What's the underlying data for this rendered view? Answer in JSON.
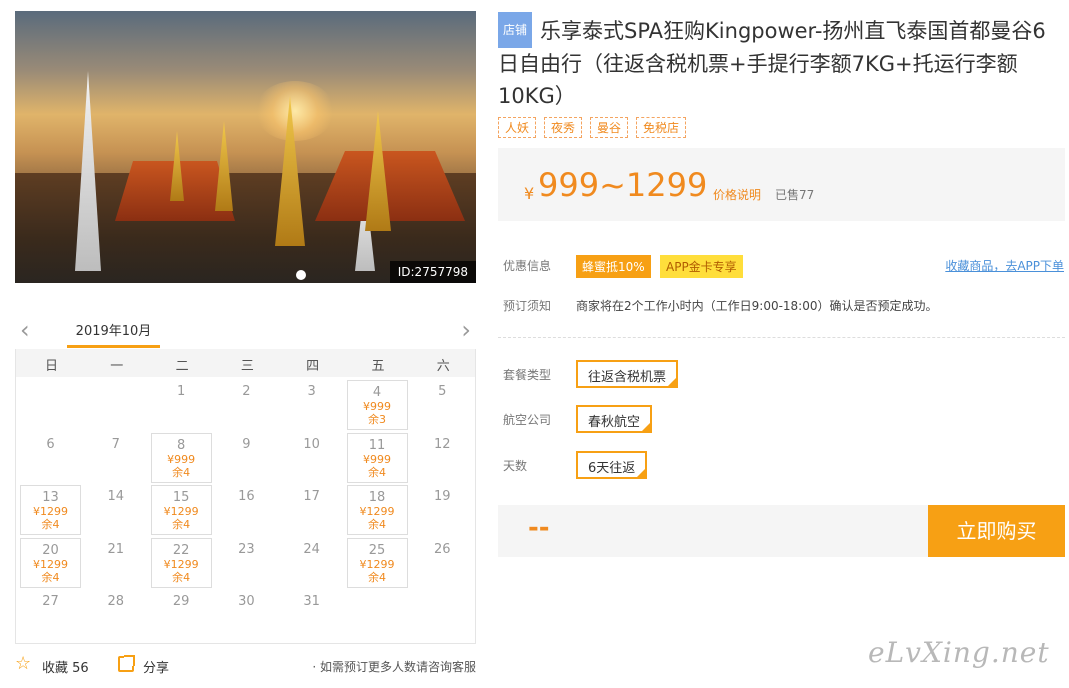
{
  "hero": {
    "id_badge": "ID:2757798"
  },
  "calendar": {
    "month": "2019年10月",
    "prev_icon": "chevron-left-icon",
    "next_icon": "chevron-right-icon",
    "weekdays": [
      "日",
      "一",
      "二",
      "三",
      "四",
      "五",
      "六"
    ],
    "days": [
      {
        "d": "1"
      },
      {
        "d": "2"
      },
      {
        "d": "3"
      },
      {
        "d": "4",
        "p": "¥999",
        "r": "余3"
      },
      {
        "d": "5"
      },
      {
        "d": "6"
      },
      {
        "d": "7"
      },
      {
        "d": "8",
        "p": "¥999",
        "r": "余4"
      },
      {
        "d": "9"
      },
      {
        "d": "10"
      },
      {
        "d": "11",
        "p": "¥999",
        "r": "余4"
      },
      {
        "d": "12"
      },
      {
        "d": "13",
        "p": "¥1299",
        "r": "余4"
      },
      {
        "d": "14"
      },
      {
        "d": "15",
        "p": "¥1299",
        "r": "余4"
      },
      {
        "d": "16"
      },
      {
        "d": "17"
      },
      {
        "d": "18",
        "p": "¥1299",
        "r": "余4"
      },
      {
        "d": "19"
      },
      {
        "d": "20",
        "p": "¥1299",
        "r": "余4"
      },
      {
        "d": "21"
      },
      {
        "d": "22",
        "p": "¥1299",
        "r": "余4"
      },
      {
        "d": "23"
      },
      {
        "d": "24"
      },
      {
        "d": "25",
        "p": "¥1299",
        "r": "余4"
      },
      {
        "d": "26"
      },
      {
        "d": "27"
      },
      {
        "d": "28"
      },
      {
        "d": "29"
      },
      {
        "d": "30"
      },
      {
        "d": "31"
      }
    ]
  },
  "bottom": {
    "fav_icon": "star-icon",
    "fav_label": "收藏 56",
    "share_icon": "share-icon",
    "share_label": "分享",
    "note": "· 如需预订更多人数请咨询客服"
  },
  "product": {
    "shop_tag": "店铺",
    "title": "乐享泰式SPA狂购Kingpower-扬州直飞泰国首都曼谷6日自由行（往返含税机票+手提行李额7KG+托运行李额10KG）",
    "tags": [
      "人妖",
      "夜秀",
      "曼谷",
      "免税店"
    ]
  },
  "price": {
    "currency": "¥",
    "range": "999~1299",
    "explain": "价格说明",
    "sold": "已售77"
  },
  "promo": {
    "label": "优惠信息",
    "badge1": "蜂蜜抵10%",
    "badge2": "APP金卡专享",
    "app_link": "收藏商品，去APP下单"
  },
  "notice": {
    "label": "预订须知",
    "text": "商家将在2个工作小时内（工作日9:00-18:00）确认是否预定成功。"
  },
  "options": {
    "package_label": "套餐类型",
    "package_value": "往返含税机票",
    "airline_label": "航空公司",
    "airline_value": "春秋航空",
    "days_label": "天数",
    "days_value": "6天往返"
  },
  "buy": {
    "total": "--",
    "button": "立即购买"
  },
  "watermark": "eLvXing.net",
  "colors": {
    "accent": "#f7a014",
    "price": "#f08a1f",
    "link": "#4a90d9",
    "shop_tag": "#7aa7e8"
  }
}
